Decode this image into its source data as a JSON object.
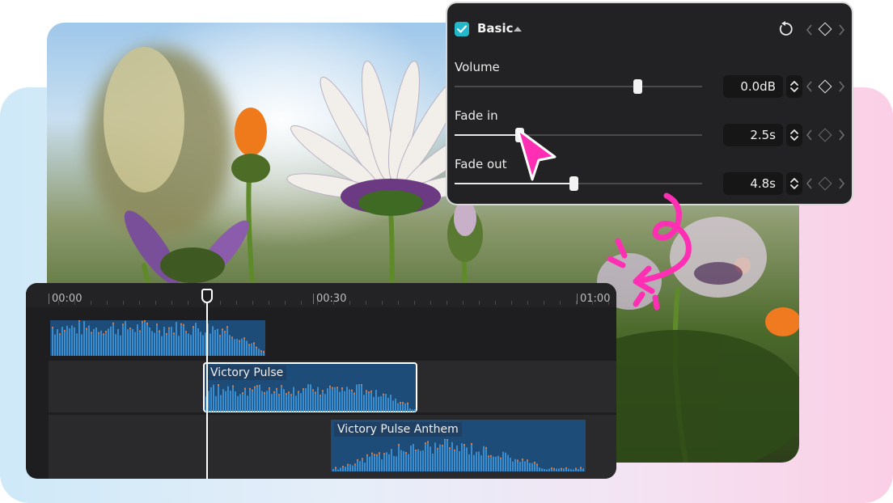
{
  "photo": {
    "alt_subject": "daisy-flowers"
  },
  "timeline": {
    "ruler": {
      "ticks": [
        "00:00",
        "00:30",
        "01:00"
      ]
    },
    "clips": [
      {
        "label": ""
      },
      {
        "label": "Victory Pulse"
      },
      {
        "label": "Victory Pulse Anthem"
      }
    ]
  },
  "panel": {
    "section_title": "Basic",
    "checkbox_checked": true,
    "controls": [
      {
        "label": "Volume",
        "value": "0.0dB",
        "level": 0.74
      },
      {
        "label": "Fade in",
        "value": "2.5s",
        "level": 0.26
      },
      {
        "label": "Fade out",
        "value": "4.8s",
        "level": 0.48
      }
    ]
  },
  "colors": {
    "accent": "#22b7c9",
    "annotation": "#ff2fb3",
    "clip": "#1d4c78"
  },
  "icons": [
    "checkbox-icon",
    "caret-up-icon",
    "reset-icon",
    "keyframe-prev-icon",
    "keyframe-diamond-icon",
    "keyframe-next-icon",
    "stepper-icon",
    "pointer-cursor-icon",
    "curly-arrow-doodle-icon"
  ]
}
